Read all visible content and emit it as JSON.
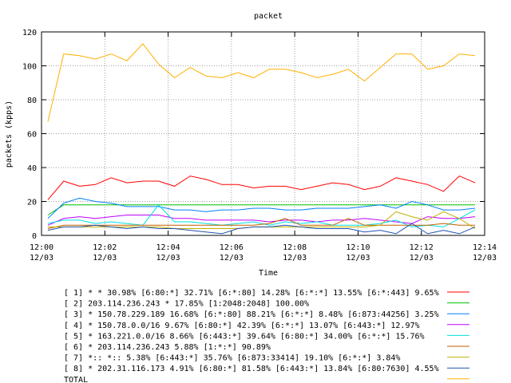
{
  "chart_data": {
    "type": "line",
    "title": "packet",
    "xlabel": "Time",
    "ylabel": "packets (kpps)",
    "ylim": [
      0,
      120
    ],
    "yticks": [
      0,
      20,
      40,
      60,
      80,
      100,
      120
    ],
    "xlim": [
      0,
      14
    ],
    "xticks": [
      {
        "value": 0,
        "line1": "12:00",
        "line2": "12/03"
      },
      {
        "value": 2,
        "line1": "12:02",
        "line2": "12/03"
      },
      {
        "value": 4,
        "line1": "12:04",
        "line2": "12/03"
      },
      {
        "value": 6,
        "line1": "12:06",
        "line2": "12/03"
      },
      {
        "value": 8,
        "line1": "12:08",
        "line2": "12/03"
      },
      {
        "value": 10,
        "line1": "12:10",
        "line2": "12/03"
      },
      {
        "value": 12,
        "line1": "12:12",
        "line2": "12/03"
      },
      {
        "value": 14,
        "line1": "12:14",
        "line2": "12/03"
      }
    ],
    "x": [
      0.2,
      0.7,
      1.2,
      1.7,
      2.2,
      2.7,
      3.2,
      3.7,
      4.2,
      4.7,
      5.2,
      5.7,
      6.2,
      6.7,
      7.2,
      7.7,
      8.2,
      8.7,
      9.2,
      9.7,
      10.2,
      10.7,
      11.2,
      11.7,
      12.2,
      12.7,
      13.2,
      13.7
    ],
    "legend_placement": "below",
    "series": [
      {
        "name": "[ 1] * * 30.98%  [6:80:*] 32.71% [6:*:80] 14.28% [6:*:*] 13.55% [6:*:443] 9.65%",
        "color": "#ff0000",
        "values": [
          21,
          32,
          29,
          30,
          34,
          31,
          32,
          32,
          29,
          35,
          33,
          30,
          30,
          28,
          29,
          29,
          27,
          29,
          31,
          30,
          27,
          29,
          34,
          32,
          30,
          26,
          35,
          31
        ]
      },
      {
        "name": "[ 2] 203.114.236.243 * 17.85%  [1:2048:2048] 100.00%",
        "color": "#00c000",
        "values": [
          12,
          18,
          18,
          18,
          18,
          18,
          18,
          18,
          18,
          18,
          18,
          18,
          18,
          18,
          18,
          18,
          18,
          18,
          18,
          18,
          18,
          18,
          18,
          18,
          18,
          18,
          18,
          18
        ]
      },
      {
        "name": "[ 3] * 150.78.229.189 16.68%  [6:*:80] 88.21% [6:*:*] 8.48% [6:873:44256] 3.25%",
        "color": "#0080ff",
        "values": [
          10,
          19,
          22,
          20,
          19,
          17,
          17,
          17,
          15,
          15,
          14,
          15,
          15,
          16,
          16,
          15,
          15,
          16,
          16,
          16,
          17,
          18,
          16,
          20,
          18,
          15,
          15,
          16
        ]
      },
      {
        "name": "[ 4] * 150.78.0.0/16 9.67%  [6:80:*] 42.39% [6:*:*] 13.07% [6:443:*] 12.97%",
        "color": "#c000ff",
        "values": [
          6,
          10,
          11,
          10,
          11,
          12,
          12,
          12,
          10,
          10,
          9,
          9,
          9,
          9,
          8,
          9,
          9,
          8,
          9,
          9,
          10,
          9,
          8,
          7,
          11,
          10,
          10,
          11
        ]
      },
      {
        "name": "[ 5] * 163.221.0.0/16 8.66%  [6:443:*] 39.64% [6:80:*] 34.00% [6:*:*] 15.76%",
        "color": "#00e0e0",
        "values": [
          7,
          9,
          9,
          7,
          8,
          7,
          6,
          18,
          8,
          8,
          7,
          6,
          7,
          8,
          6,
          8,
          7,
          8,
          6,
          6,
          6,
          7,
          9,
          5,
          6,
          5,
          10,
          15
        ]
      },
      {
        "name": "[ 6] * 203.114.236.243 5.88%  [1:*:*] 90.89%",
        "color": "#c06000",
        "values": [
          4,
          6,
          6,
          6,
          6,
          6,
          6,
          6,
          6,
          6,
          6,
          6,
          6,
          6,
          7,
          10,
          6,
          6,
          6,
          10,
          6,
          6,
          6,
          6,
          6,
          7,
          6,
          6
        ]
      },
      {
        "name": "[ 7] *:: *:: 5.38%  [6:443:*] 35.76% [6:873:33414] 19.10% [6:*:*] 3.84%",
        "color": "#c0b000",
        "values": [
          5,
          5,
          5,
          5,
          5,
          5,
          5,
          5,
          4,
          4,
          4,
          4,
          4,
          5,
          5,
          5,
          5,
          5,
          5,
          5,
          5,
          6,
          14,
          11,
          9,
          14,
          10,
          4
        ]
      },
      {
        "name": "[ 8] * 202.31.116.173 4.91%  [6:80:*] 81.58% [6:443:*] 13.84% [6:80:7630] 4.55%",
        "color": "#2050b0",
        "values": [
          3,
          5,
          5,
          6,
          5,
          4,
          5,
          4,
          4,
          3,
          2,
          1,
          4,
          5,
          5,
          6,
          5,
          4,
          4,
          4,
          2,
          3,
          1,
          7,
          1,
          3,
          1,
          5
        ]
      },
      {
        "name": "TOTAL",
        "color": "#ffb000",
        "values": [
          67,
          107,
          106,
          104,
          107,
          103,
          113,
          101,
          93,
          99,
          94,
          93,
          96,
          93,
          98,
          98,
          96,
          93,
          95,
          98,
          91,
          99,
          107,
          107,
          98,
          100,
          107,
          106
        ]
      }
    ]
  }
}
